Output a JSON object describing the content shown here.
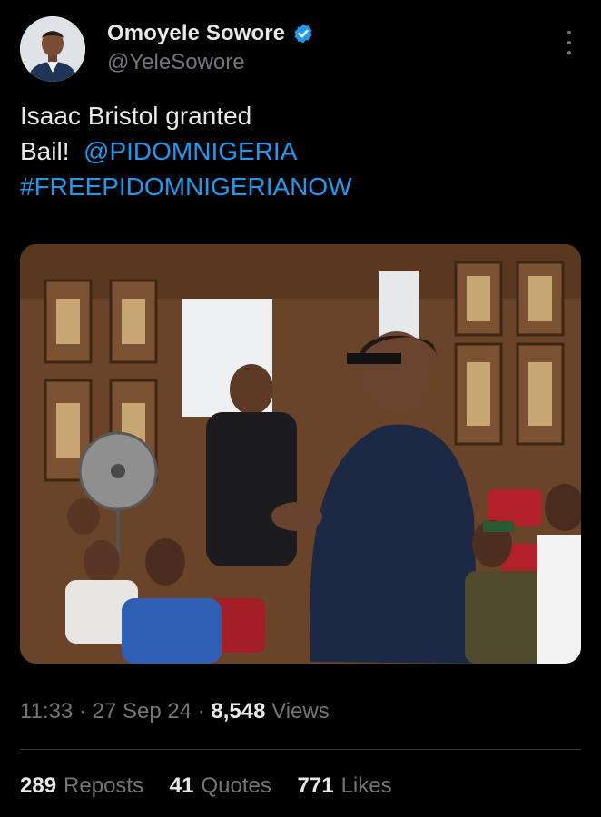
{
  "author": {
    "display_name": "Omoyele Sowore",
    "handle": "@YeleSowore",
    "verified_icon": "verified-badge-icon",
    "more_icon": "more-options-icon"
  },
  "tweet": {
    "line1": "Isaac Bristol granted",
    "line2_text": "Bail!",
    "mention": "@PIDOMNIGERIA",
    "hashtag": "#FREEPIDOMNIGERIANOW"
  },
  "meta": {
    "time": "11:33",
    "separator": "·",
    "date": "27 Sep 24",
    "views_count": "8,548",
    "views_label": "Views"
  },
  "stats": {
    "reposts_count": "289",
    "reposts_label": "Reposts",
    "quotes_count": "41",
    "quotes_label": "Quotes",
    "likes_count": "771",
    "likes_label": "Likes"
  },
  "colors": {
    "background": "#000000",
    "primary_text": "#e7e9ea",
    "secondary_text": "#71767b",
    "link": "#1d9bf0",
    "divider": "#2f3336"
  }
}
